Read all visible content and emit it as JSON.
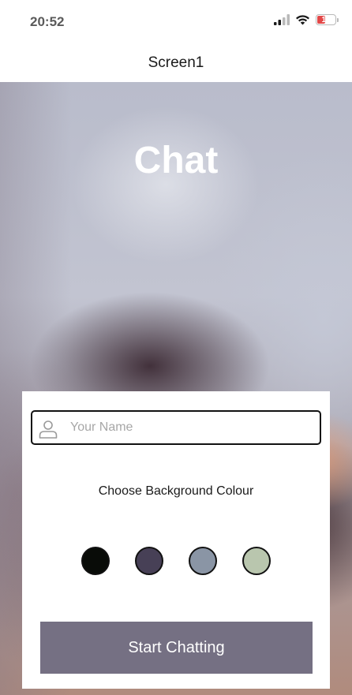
{
  "status_bar": {
    "time": "20:52",
    "battery_level": "14",
    "icons": [
      "cellular-signal-icon",
      "wifi-icon",
      "battery-icon"
    ]
  },
  "header": {
    "title": "Screen1"
  },
  "main": {
    "app_title": "Chat",
    "name_input": {
      "placeholder": "Your Name",
      "value": "",
      "icon": "person-icon"
    },
    "choose_label": "Choose Background Colour",
    "colours": [
      {
        "name": "black",
        "hex": "#090C08"
      },
      {
        "name": "purple",
        "hex": "#474056"
      },
      {
        "name": "grey",
        "hex": "#8A95A5"
      },
      {
        "name": "green",
        "hex": "#B9C6AE"
      }
    ],
    "start_button_label": "Start Chatting"
  },
  "colors": {
    "accent": "#757083",
    "battery_low": "#E34848"
  }
}
